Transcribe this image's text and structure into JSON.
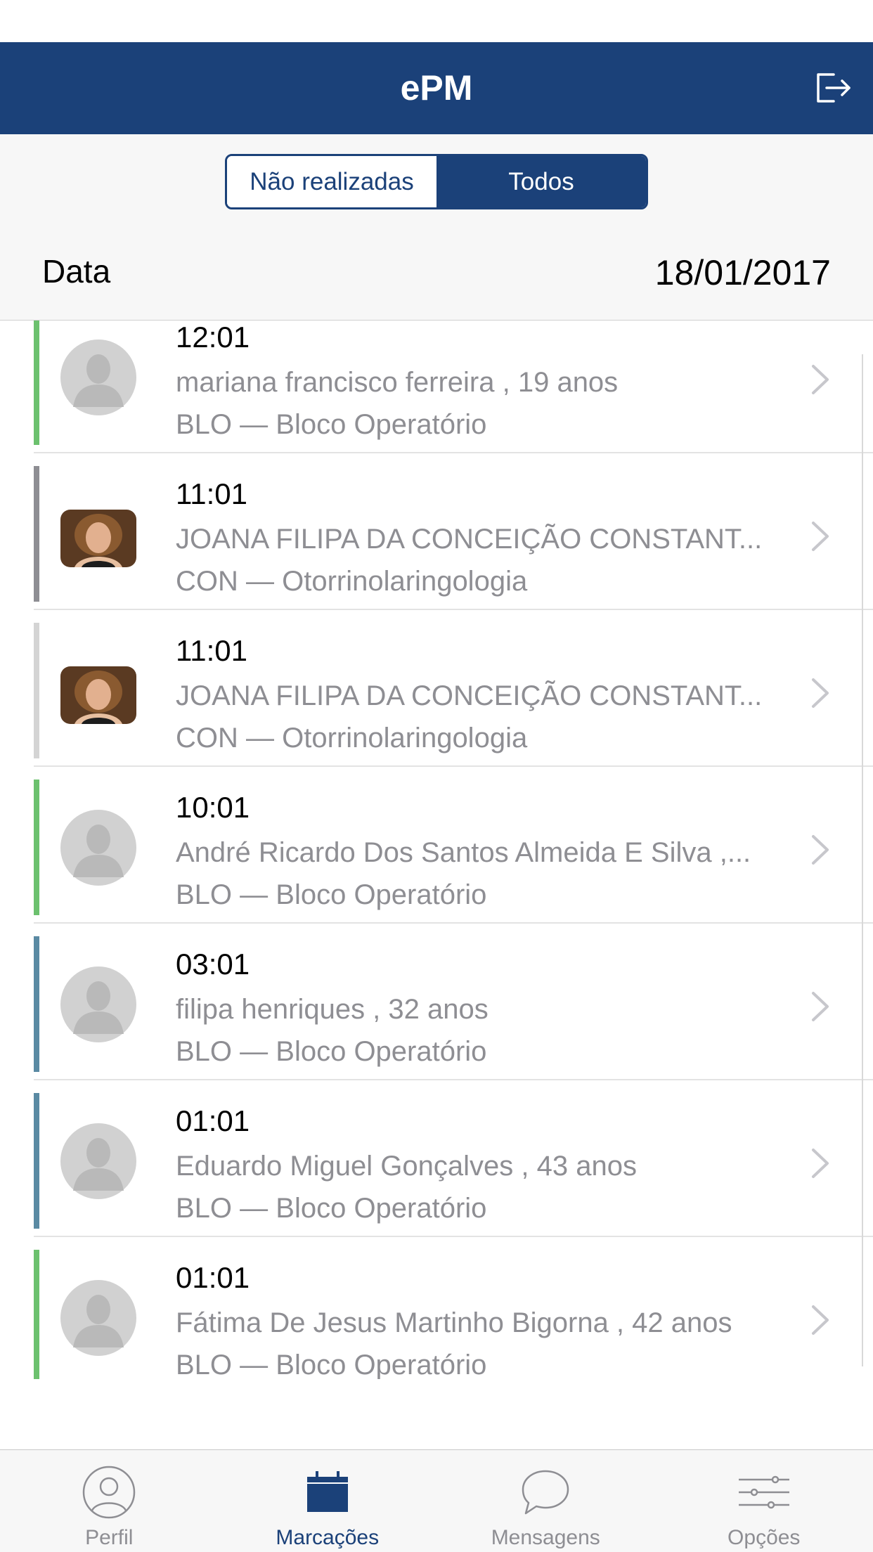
{
  "header": {
    "title": "ePM"
  },
  "filter": {
    "segments": [
      "Não realizadas",
      "Todos"
    ],
    "date_label": "Data",
    "date_value": "18/01/2017"
  },
  "appointments": [
    {
      "time": "12:01",
      "name": "mariana francisco ferreira , 19 anos",
      "service": "BLO — Bloco Operatório",
      "status_color": "#6cc16e",
      "avatar": "placeholder"
    },
    {
      "time": "11:01",
      "name": "JOANA FILIPA DA CONCEIÇÃO CONSTANT...",
      "service": "CON — Otorrinolaringologia",
      "status_color": "#8e8e93",
      "avatar": "photo"
    },
    {
      "time": "11:01",
      "name": "JOANA FILIPA DA CONCEIÇÃO CONSTANT...",
      "service": "CON — Otorrinolaringologia",
      "status_color": "#d4d4d4",
      "avatar": "photo"
    },
    {
      "time": "10:01",
      "name": "André Ricardo Dos Santos Almeida E Silva ,...",
      "service": "BLO — Bloco Operatório",
      "status_color": "#6cc16e",
      "avatar": "placeholder"
    },
    {
      "time": "03:01",
      "name": "filipa henriques , 32 anos",
      "service": "BLO — Bloco Operatório",
      "status_color": "#5a8aa3",
      "avatar": "placeholder"
    },
    {
      "time": "01:01",
      "name": "Eduardo Miguel Gonçalves , 43 anos",
      "service": "BLO — Bloco Operatório",
      "status_color": "#5a8aa3",
      "avatar": "placeholder"
    },
    {
      "time": "01:01",
      "name": "Fátima De Jesus Martinho Bigorna , 42 anos",
      "service": "BLO — Bloco Operatório",
      "status_color": "#6cc16e",
      "avatar": "placeholder"
    }
  ],
  "tabs": [
    {
      "label": "Perfil",
      "icon": "profile-icon"
    },
    {
      "label": "Marcações",
      "icon": "calendar-icon"
    },
    {
      "label": "Mensagens",
      "icon": "chat-icon"
    },
    {
      "label": "Opções",
      "icon": "sliders-icon"
    }
  ],
  "colors": {
    "primary": "#1b4179",
    "secondary_text": "#8e8e93"
  }
}
